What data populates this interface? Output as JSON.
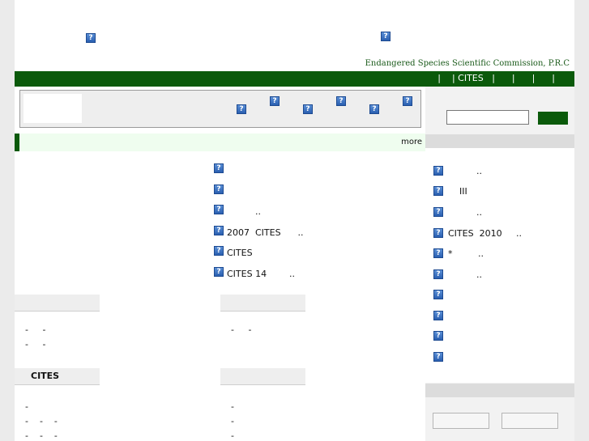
{
  "header": {
    "commission_name": "Endangered Species Scientific Commission, P.R.C"
  },
  "nav": {
    "text": "|    | CITES   |      |      |      |"
  },
  "feature": {
    "more_label": "more"
  },
  "news_items": [
    {
      "text": ""
    },
    {
      "text": ""
    },
    {
      "text": "          .."
    },
    {
      "text": "2007  CITES      .."
    },
    {
      "text": "CITES"
    },
    {
      "text": "CITES 14        .."
    }
  ],
  "sections": [
    {
      "title": "",
      "lines": [
        "-     -",
        "-     -"
      ]
    },
    {
      "title": "",
      "lines": [
        "-     -"
      ]
    },
    {
      "title": "CITES",
      "lines": [
        "-",
        "-    -    -",
        "-    -    -"
      ]
    },
    {
      "title": "",
      "lines": [
        "-",
        "-",
        "-"
      ]
    }
  ],
  "right_list": [
    {
      "text": "          .."
    },
    {
      "text": "    III"
    },
    {
      "text": "          .."
    },
    {
      "text": "CITES  2010     .."
    },
    {
      "text": "*         .."
    },
    {
      "text": "          .."
    },
    {
      "text": ""
    },
    {
      "text": ""
    },
    {
      "text": ""
    },
    {
      "text": ""
    }
  ]
}
